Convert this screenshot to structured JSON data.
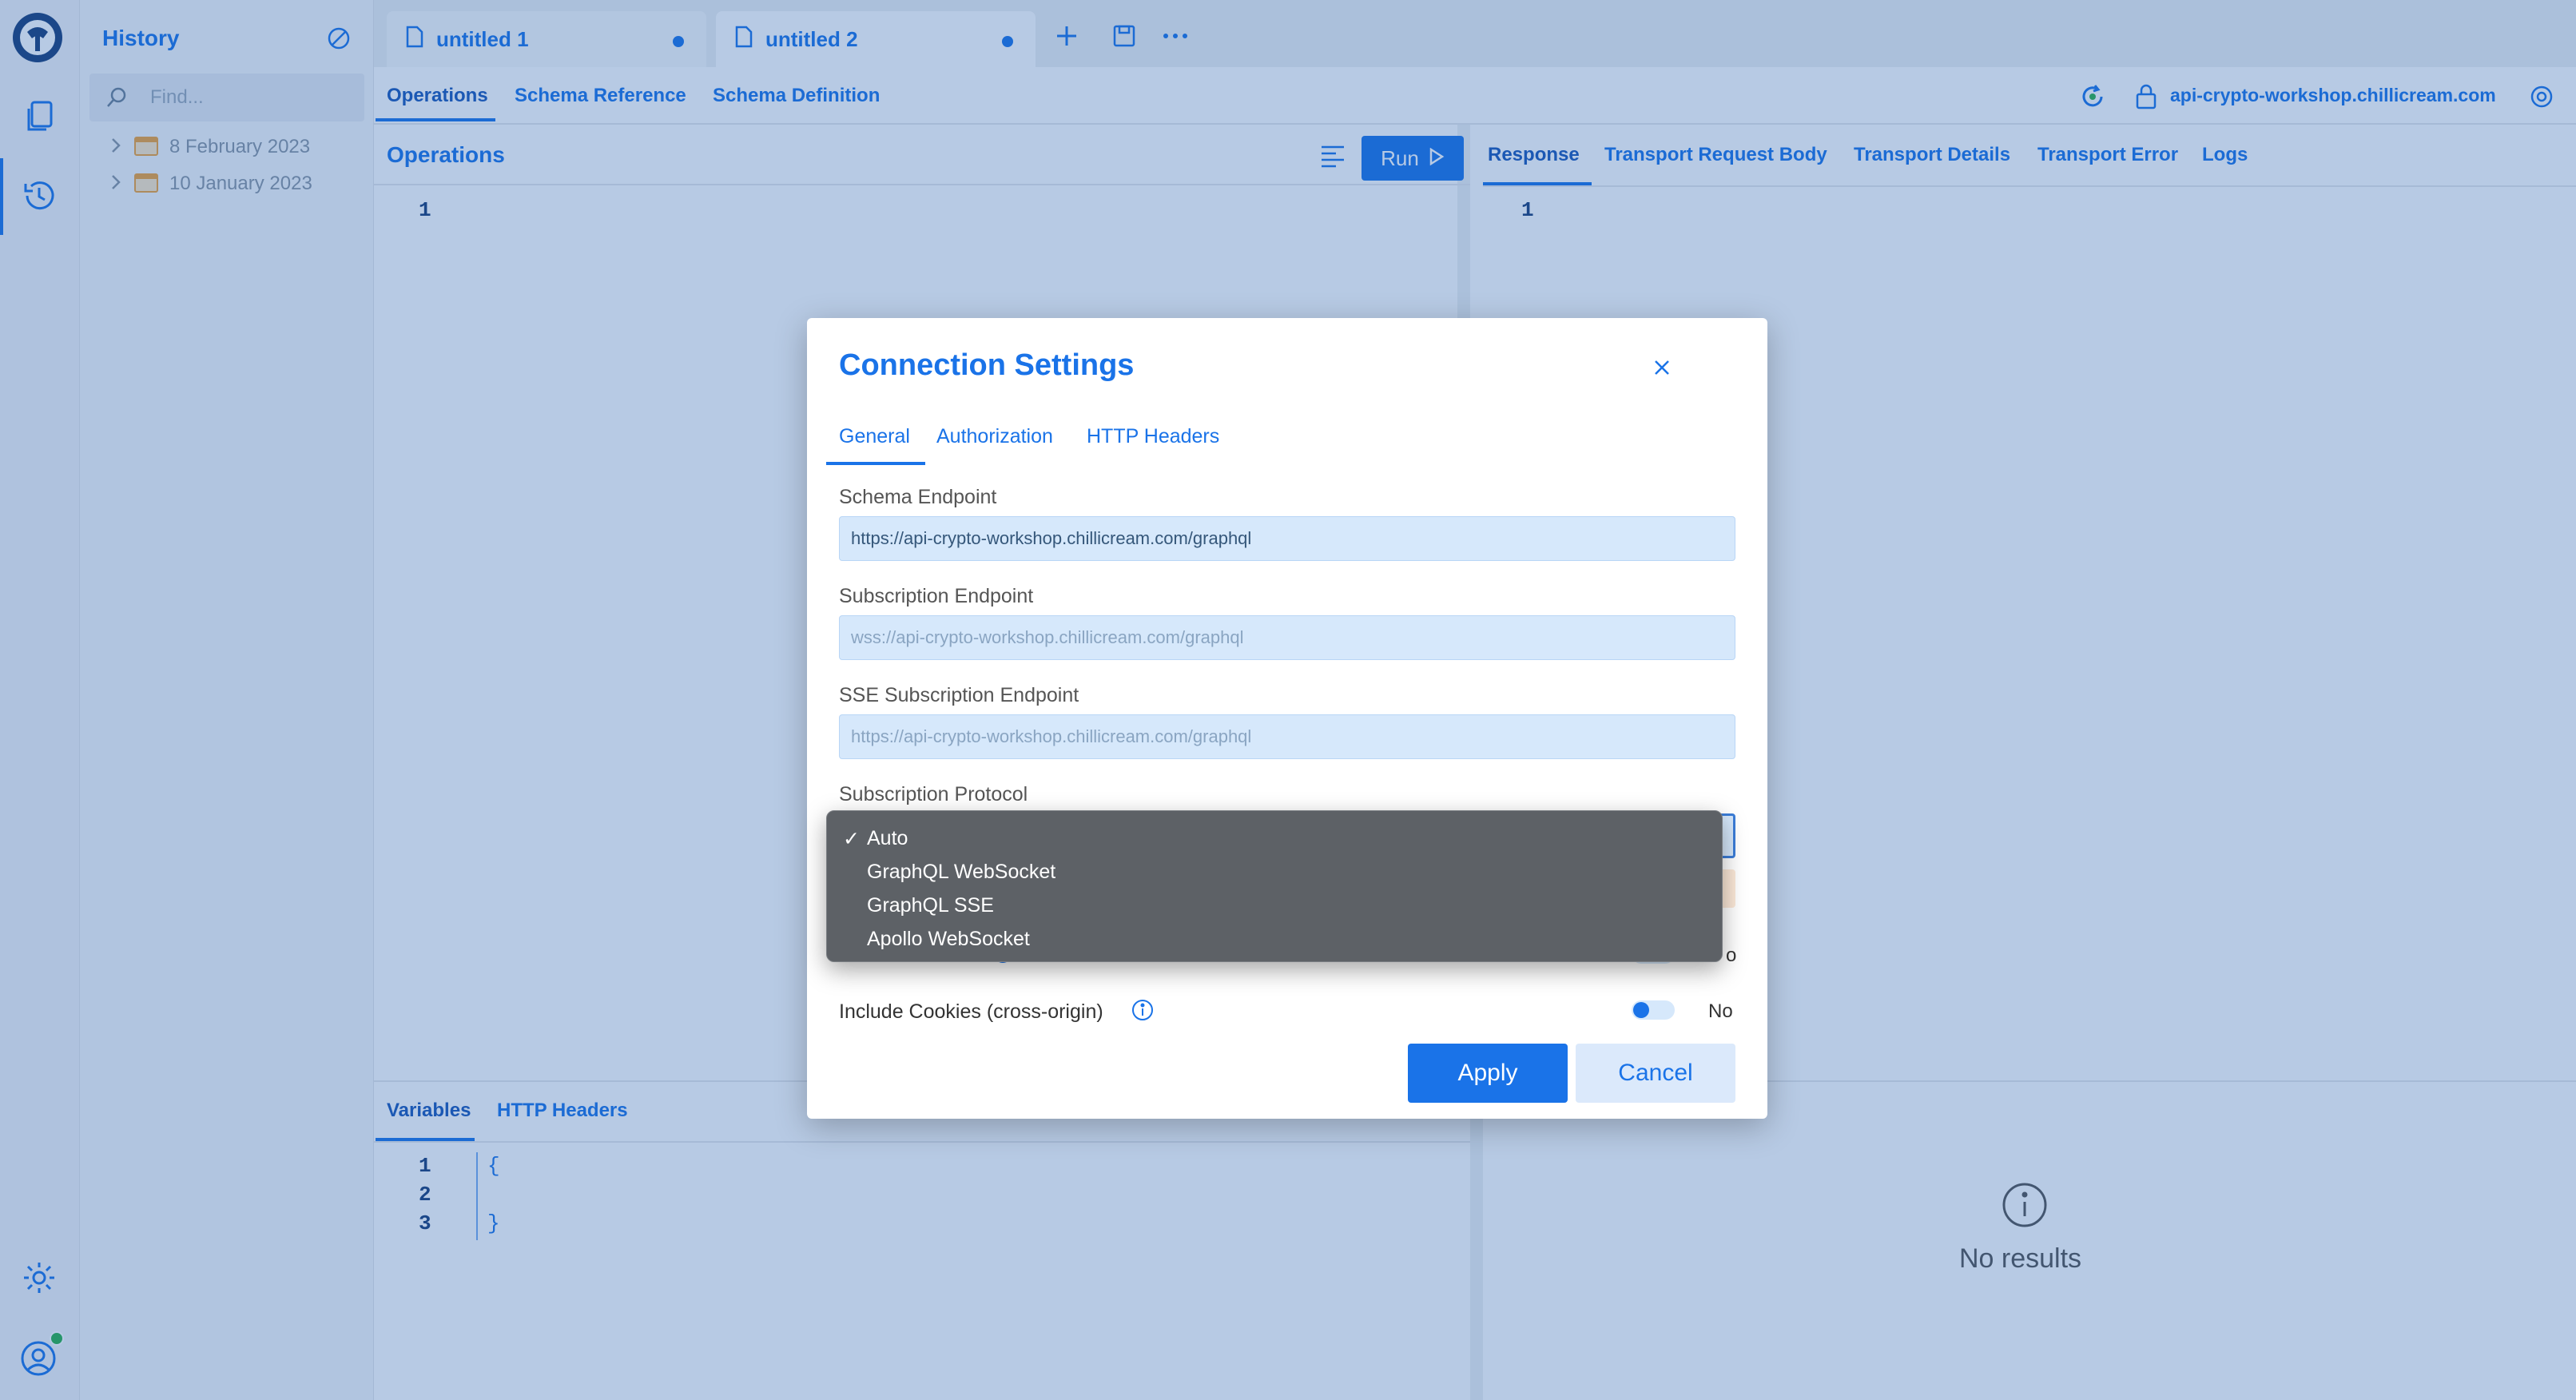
{
  "sidebar": {
    "title": "History",
    "search_placeholder": "Find...",
    "groups": [
      {
        "label": "8 February 2023"
      },
      {
        "label": "10 January 2023"
      }
    ]
  },
  "doc_tabs": [
    {
      "label": "untitled 1"
    },
    {
      "label": "untitled 2"
    }
  ],
  "nav": {
    "operations": "Operations",
    "schema_reference": "Schema Reference",
    "schema_definition": "Schema Definition",
    "endpoint": "api-crypto-workshop.chillicream.com"
  },
  "operations_panel": {
    "title": "Operations",
    "run_label": "Run",
    "line": "1"
  },
  "response_panel": {
    "tabs": [
      "Response",
      "Transport Request Body",
      "Transport Details",
      "Transport Error",
      "Logs"
    ],
    "line": "1",
    "empty_text": "No results"
  },
  "variables_panel": {
    "tabs": [
      "Variables",
      "HTTP Headers"
    ],
    "line_numbers": [
      "1",
      "2",
      "3"
    ],
    "code": [
      "{",
      "",
      "}"
    ]
  },
  "modal": {
    "title": "Connection Settings",
    "tabs": [
      "General",
      "Authorization",
      "HTTP Headers"
    ],
    "schema_endpoint_label": "Schema Endpoint",
    "schema_endpoint_value": "https://api-crypto-workshop.chillicream.com/graphql",
    "subscription_endpoint_label": "Subscription Endpoint",
    "subscription_endpoint_placeholder": "wss://api-crypto-workshop.chillicream.com/graphql",
    "sse_endpoint_label": "SSE Subscription Endpoint",
    "sse_endpoint_placeholder": "https://api-crypto-workshop.chillicream.com/graphql",
    "subscription_protocol_label": "Subscription Protocol",
    "include_cookies_label": "Include Cookies (cross-origin)",
    "include_cookies_value": "No",
    "hidden_toggle_value_fragment": "o",
    "apply_label": "Apply",
    "cancel_label": "Cancel"
  },
  "dropdown": {
    "check": "✓",
    "options": [
      "Auto",
      "GraphQL WebSocket",
      "GraphQL SSE",
      "Apollo WebSocket"
    ],
    "selected": "Auto"
  },
  "colors": {
    "accent": "#1a73e8",
    "overlay": "rgba(30,90,170,0.32)",
    "dropdown_bg": "#5d6166"
  }
}
